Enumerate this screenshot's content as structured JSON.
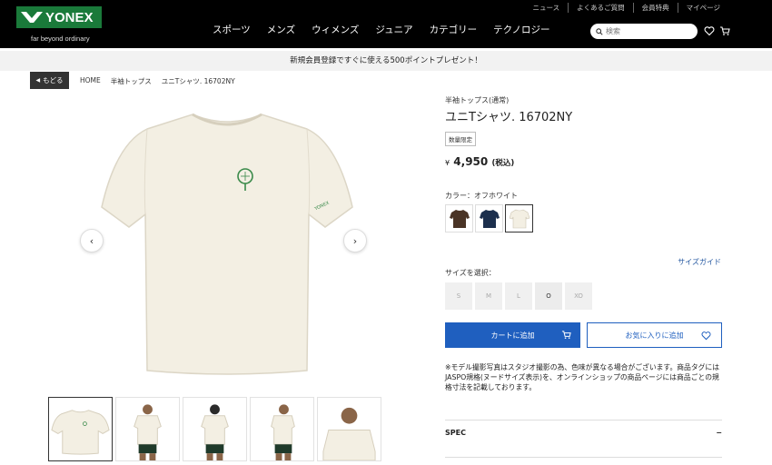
{
  "header": {
    "logo_text": "YONEX",
    "tagline": "far beyond ordinary",
    "utility_links": [
      "ニュース",
      "よくあるご質問",
      "会員特典",
      "マイページ"
    ],
    "nav": [
      "スポーツ",
      "メンズ",
      "ウィメンズ",
      "ジュニア",
      "カテゴリー",
      "テクノロジー"
    ],
    "search_placeholder": "検索",
    "icons": [
      "search-icon",
      "heart-icon",
      "cart-icon"
    ]
  },
  "promo": {
    "text": "新規会員登録ですぐに使える500ポイントプレゼント！"
  },
  "breadcrumb": {
    "back_label": "もどる",
    "items": [
      "HOME",
      "半袖トップス",
      "ユニTシャツ. 16702NY"
    ]
  },
  "product": {
    "category": "半袖トップス(通常)",
    "title": "ユニTシャツ. 16702NY",
    "badge": "数量限定",
    "price_currency": "¥",
    "price_value": "4,950",
    "price_tax": "(税込)",
    "color_label": "カラー：オフホワイト",
    "colors": [
      {
        "name": "brown",
        "hex": "#4a3426"
      },
      {
        "name": "navy",
        "hex": "#1c2f4d"
      },
      {
        "name": "off-white",
        "hex": "#f3efe3"
      }
    ],
    "selected_color_index": 2,
    "size_guide": "サイズガイド",
    "size_label": "サイズを選択：",
    "sizes": [
      {
        "label": "S",
        "available": false
      },
      {
        "label": "M",
        "available": false
      },
      {
        "label": "L",
        "available": false
      },
      {
        "label": "O",
        "available": true
      },
      {
        "label": "XO",
        "available": false
      }
    ],
    "cart_button": "カートに追加",
    "favorite_button": "お気に入りに追加",
    "note": "※モデル撮影写真はスタジオ撮影の為、色味が異なる場合がございます。商品タグにはJASPO規格(ヌードサイズ表示)を、オンラインショップの商品ページには商品ごとの規格寸法を記載しております。",
    "spec_label": "SPEC",
    "spec_toggle": "−"
  },
  "gallery": {
    "thumbnail_count": 5,
    "active_index": 0,
    "prev_label": "‹",
    "next_label": "›"
  },
  "colors": {
    "header_bg": "#000000",
    "logo_green": "#1a7a3a",
    "accent_blue": "#1f5fbf",
    "shirt": "#f3efe3"
  }
}
